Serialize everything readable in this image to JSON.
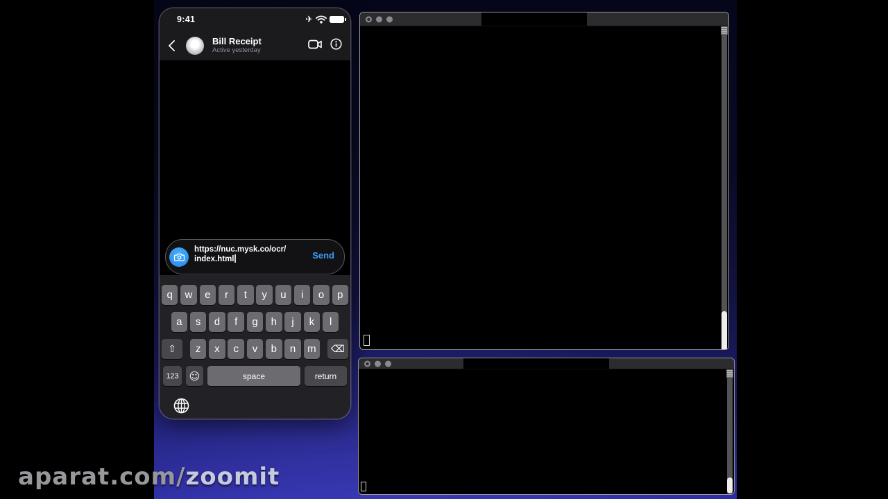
{
  "watermark": {
    "prefix": "aparat.com/",
    "suffix": "zoomit"
  },
  "phone": {
    "status_bar": {
      "time": "9:41",
      "airplane_glyph": "✈"
    },
    "header": {
      "title": "Bill Receipt",
      "subtitle": "Active yesterday"
    },
    "composer": {
      "message_line1": "https://nuc.mysk.co/ocr/",
      "message_line2": "index.html",
      "send_label": "Send"
    },
    "keyboard": {
      "row1": [
        "q",
        "w",
        "e",
        "r",
        "t",
        "y",
        "u",
        "i",
        "o",
        "p"
      ],
      "row2": [
        "a",
        "s",
        "d",
        "f",
        "g",
        "h",
        "j",
        "k",
        "l"
      ],
      "row3": [
        "z",
        "x",
        "c",
        "v",
        "b",
        "n",
        "m"
      ],
      "shift_glyph": "⇧",
      "backspace_glyph": "⌫",
      "numbers_label": "123",
      "emoji_glyph": "☺",
      "space_label": "space",
      "return_label": "return"
    }
  },
  "colors": {
    "accent_blue": "#3b9df5",
    "camera_button_blue": "#3797f0",
    "background_blue": "#2b2b9e",
    "key_gray": "#6b6b70",
    "key_dark_gray": "#47474c"
  }
}
